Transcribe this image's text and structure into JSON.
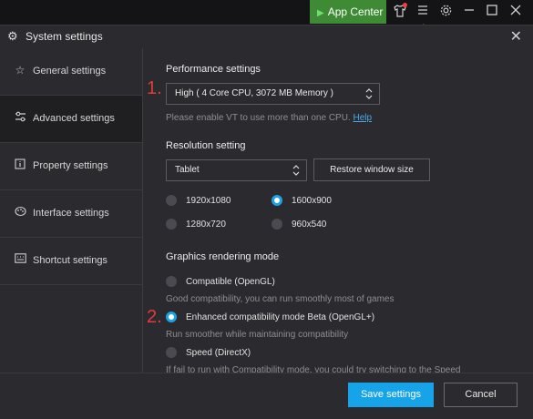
{
  "topbar": {
    "app_center_label": "App Center",
    "icons": [
      "shirt-icon",
      "menu-icon",
      "gear-icon",
      "minimize-icon",
      "maximize-icon",
      "close-icon"
    ]
  },
  "dialog": {
    "title": "System settings",
    "close_glyph": "✕"
  },
  "sidebar": {
    "items": [
      {
        "label": "General settings",
        "icon": "star-icon"
      },
      {
        "label": "Advanced settings",
        "icon": "sliders-icon"
      },
      {
        "label": "Property settings",
        "icon": "info-icon"
      },
      {
        "label": "Interface settings",
        "icon": "palette-icon"
      },
      {
        "label": "Shortcut settings",
        "icon": "keyboard-icon"
      }
    ],
    "active_index": 1
  },
  "performance": {
    "heading": "Performance settings",
    "selected": "High ( 4 Core CPU, 3072 MB Memory )",
    "hint": "Please enable VT to use more than one CPU.",
    "help_link": "Help"
  },
  "resolution": {
    "heading": "Resolution setting",
    "device_selected": "Tablet",
    "restore_button": "Restore window size",
    "options": [
      {
        "label": "1920x1080",
        "selected": false
      },
      {
        "label": "1600x900",
        "selected": true
      },
      {
        "label": "1280x720",
        "selected": false
      },
      {
        "label": "960x540",
        "selected": false
      }
    ]
  },
  "graphics": {
    "heading": "Graphics rendering mode",
    "options": [
      {
        "label": "Compatible (OpenGL)",
        "desc": "Good compatibility, you can run smoothly most of games",
        "selected": false
      },
      {
        "label": "Enhanced compatibility mode Beta (OpenGL+)",
        "desc": "Run smoother while maintaining compatibility",
        "selected": true
      },
      {
        "label": "Speed (DirectX)",
        "desc": "If fail to run with Compatibility mode, you could try switching to the Speed",
        "selected": false
      }
    ]
  },
  "annotations": {
    "step1": "1.",
    "step2": "2."
  },
  "footer": {
    "save_label": "Save settings",
    "cancel_label": "Cancel"
  },
  "colors": {
    "accent": "#17a3e8",
    "app_center_bg": "#3f8a35",
    "annotation_red": "#e23b3b"
  }
}
